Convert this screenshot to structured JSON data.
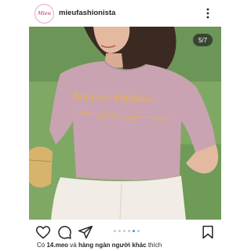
{
  "header": {
    "avatar_text": "Mieu",
    "username": "mieufashionista",
    "more_icon": "more-vertical-icon"
  },
  "post": {
    "counter": "5/7",
    "shirt_line1": "Bonjour Madame",
    "shirt_line2": "10 - 8 - 189X",
    "carousel": {
      "total": 7,
      "current": 5
    }
  },
  "actions": {
    "like_icon": "heart-icon",
    "comment_icon": "comment-icon",
    "share_icon": "send-icon",
    "save_icon": "bookmark-icon"
  },
  "likes": {
    "prefix": "Có",
    "user": "14.meo",
    "connector": "và",
    "others": "hàng ngàn người khác",
    "suffix": "thích"
  },
  "colors": {
    "accent": "#3897f0",
    "avatar_ring": "#e7a8c8",
    "shirt": "#c9a3b2",
    "print": "#e7b24a"
  }
}
